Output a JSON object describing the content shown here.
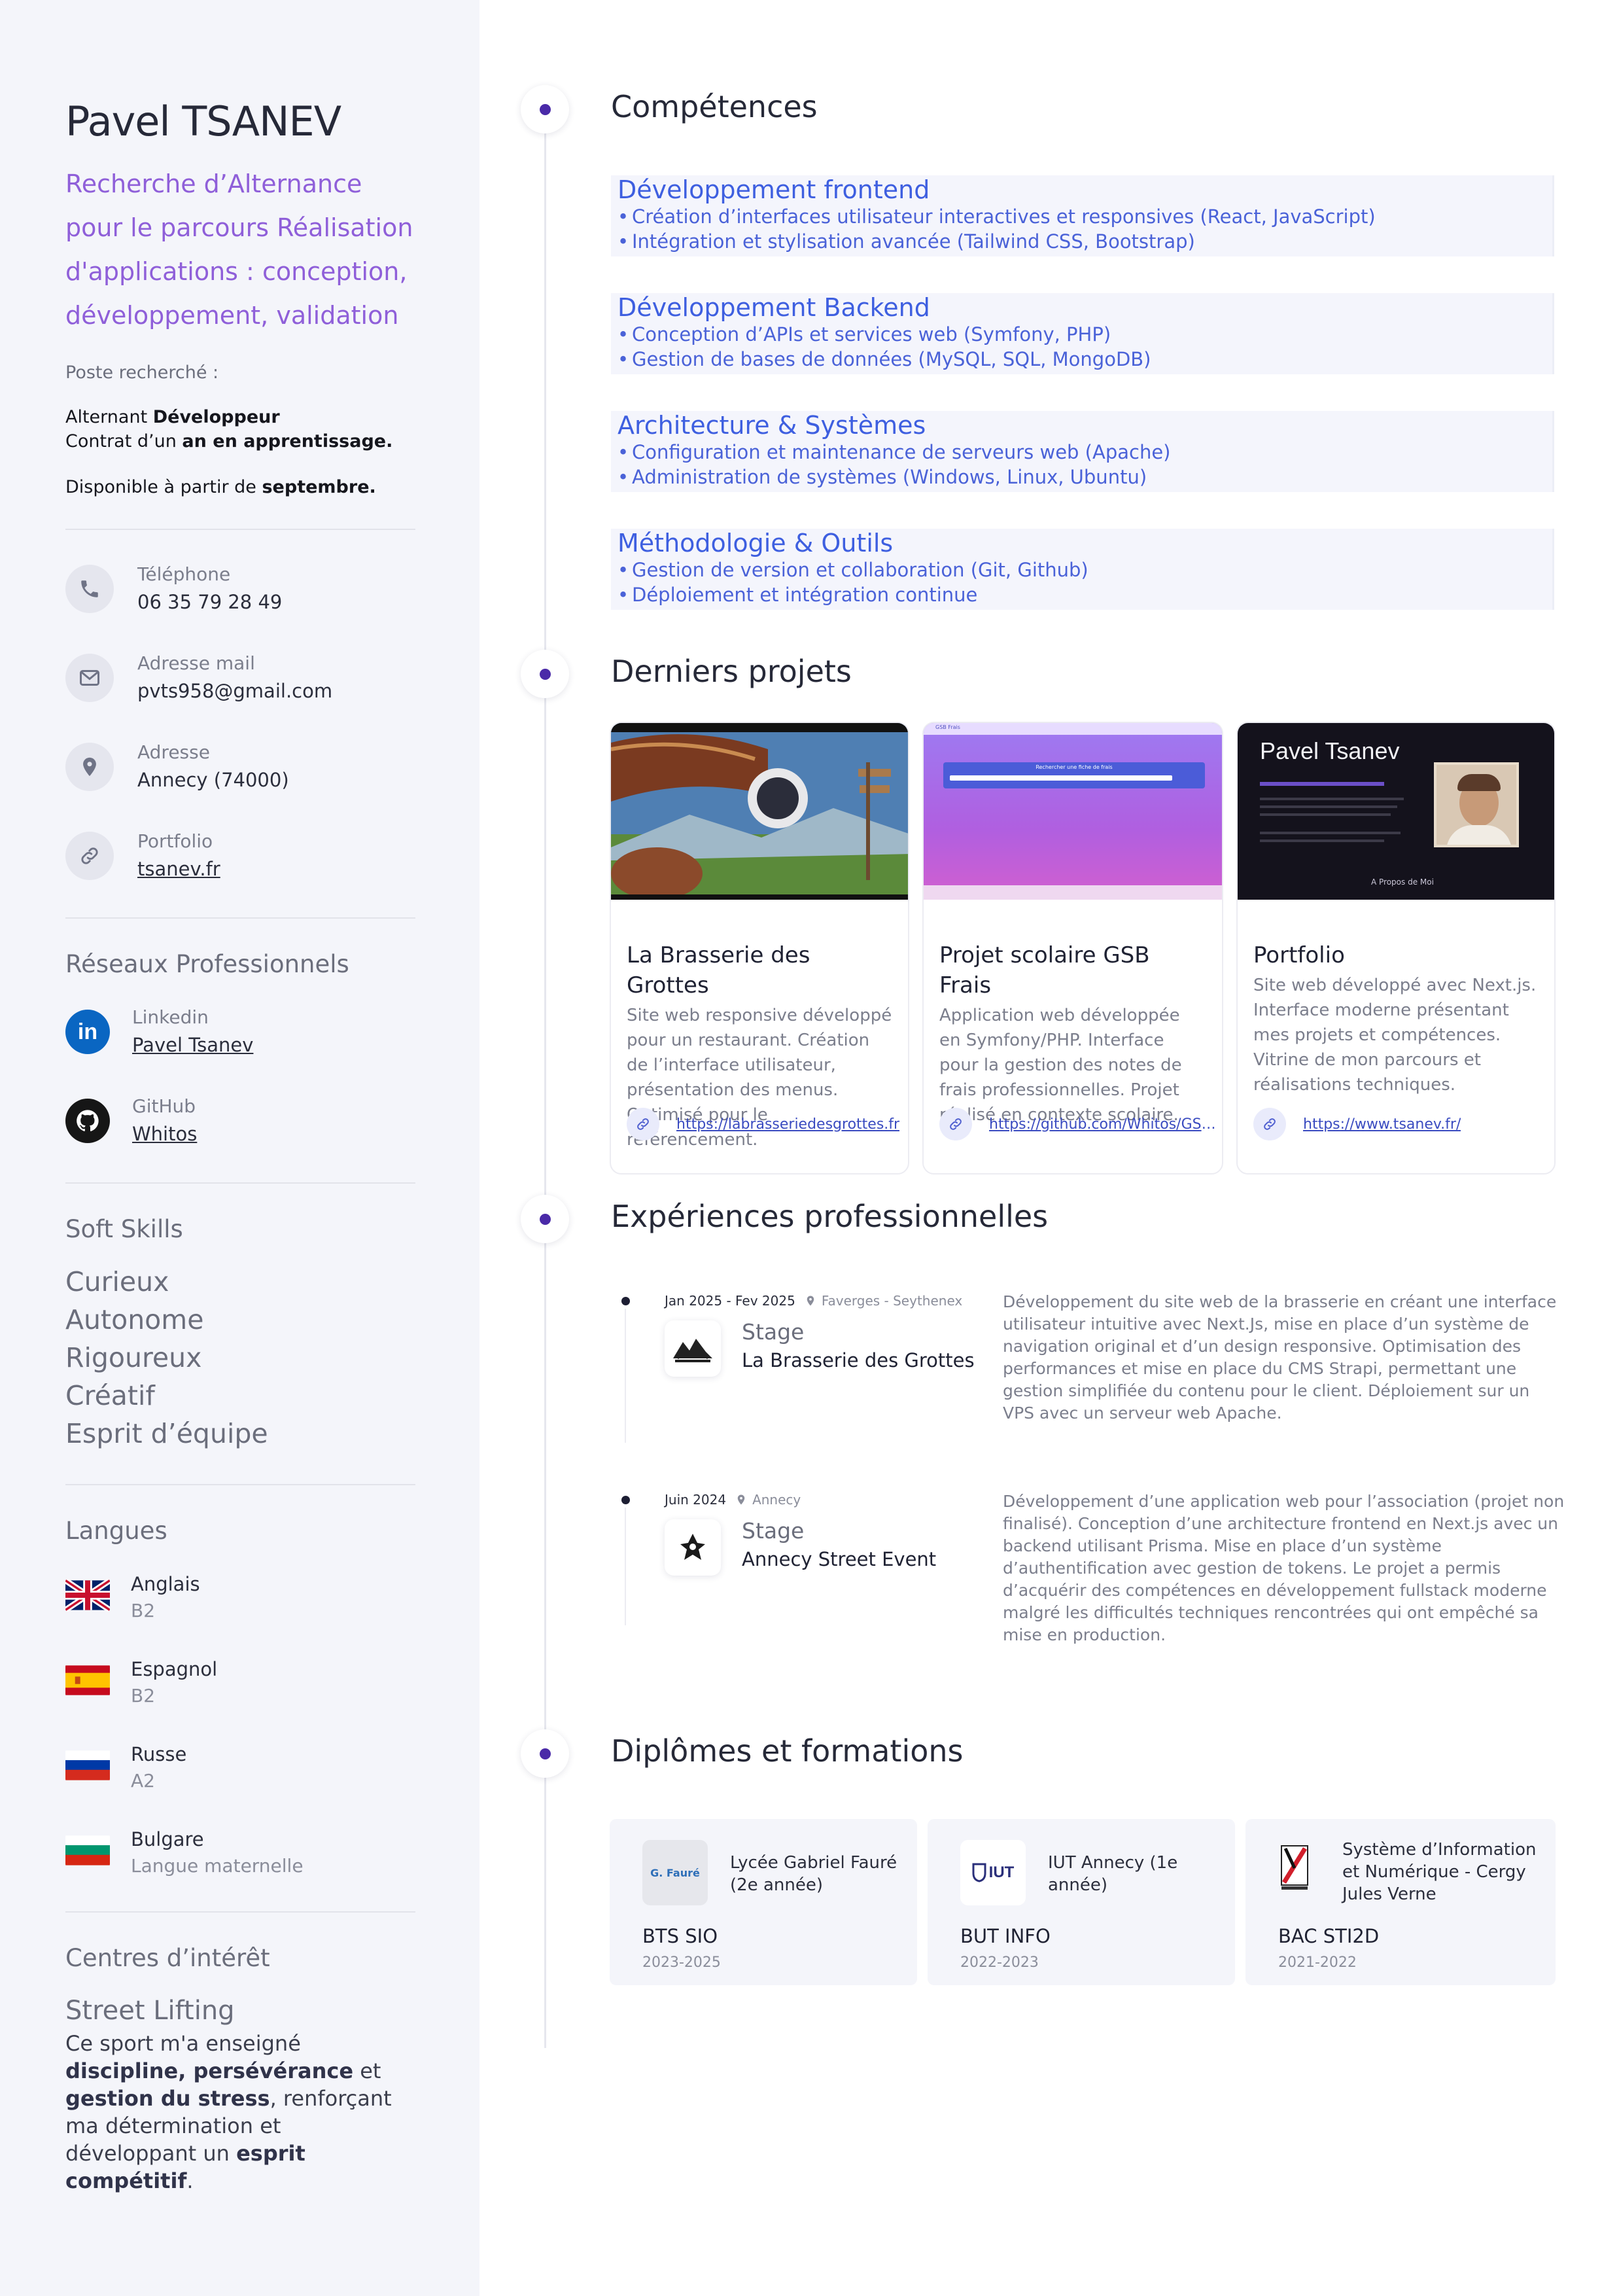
{
  "profile": {
    "name": "Pavel TSANEV",
    "headline": "Recherche d’Alternance pour le parcours Réalisation d'applications : conception, développement, validation",
    "poste_label": "Poste recherché :",
    "poste_line1_prefix": "Alternant ",
    "poste_line1_bold": "Développeur",
    "poste_line2_prefix": "Contrat d’un ",
    "poste_line2_bold": "an en apprentissage.",
    "dispo_prefix": "Disponible à partir de ",
    "dispo_bold": "septembre."
  },
  "contacts": [
    {
      "label": "Téléphone",
      "value": "06 35 79 28 49",
      "icon": "phone-icon"
    },
    {
      "label": "Adresse mail",
      "value": "pvts958@gmail.com",
      "icon": "mail-icon"
    },
    {
      "label": "Adresse",
      "value": "Annecy (74000)",
      "icon": "location-icon"
    },
    {
      "label": "Portfolio",
      "value": "tsanev.fr",
      "icon": "link-icon"
    }
  ],
  "networks": {
    "title": "Réseaux Professionnels",
    "items": [
      {
        "label": "Linkedin",
        "value": "Pavel Tsanev",
        "icon": "linkedin-icon",
        "color": "#0a66c2"
      },
      {
        "label": "GitHub",
        "value": "Whitos",
        "icon": "github-icon",
        "color": "#161616"
      }
    ]
  },
  "soft_skills": {
    "title": "Soft Skills",
    "items": [
      "Curieux",
      "Autonome",
      "Rigoureux",
      "Créatif",
      "Esprit d’équipe"
    ]
  },
  "languages": {
    "title": "Langues",
    "items": [
      {
        "name": "Anglais",
        "level": "B2",
        "icon": "uk-flag-icon"
      },
      {
        "name": "Espagnol",
        "level": "B2",
        "icon": "spain-flag-icon"
      },
      {
        "name": "Russe",
        "level": "A2",
        "icon": "russia-flag-icon"
      },
      {
        "name": "Bulgare",
        "level": "Langue maternelle",
        "icon": "bulgaria-flag-icon"
      }
    ]
  },
  "interests": {
    "title": "Centres d’intérêt",
    "item_title": "Street Lifting",
    "t1": "Ce sport m'a enseigné ",
    "b1": "discipline, persévérance",
    "t2": " et ",
    "b2": "gestion du stress",
    "t3": ", renforçant ma détermination et développant un ",
    "b3": "esprit compétitif",
    "t4": "."
  },
  "sections": {
    "skills": "Compétences",
    "projects": "Derniers projets",
    "experiences": "Expériences professionnelles",
    "education": "Diplômes et formations"
  },
  "skills": [
    {
      "title": "Développement frontend",
      "items": [
        "Création d’interfaces utilisateur interactives et responsives (React, JavaScript)",
        "Intégration et stylisation avancée (Tailwind CSS, Bootstrap)"
      ]
    },
    {
      "title": "Développement Backend",
      "items": [
        "Conception d’APIs et services web (Symfony, PHP)",
        "Gestion de bases de données (MySQL, SQL, MongoDB)"
      ]
    },
    {
      "title": "Architecture & Systèmes",
      "items": [
        "Configuration et maintenance de serveurs web (Apache)",
        "Administration de systèmes (Windows, Linux, Ubuntu)"
      ]
    },
    {
      "title": "Méthodologie & Outils",
      "items": [
        "Gestion de version et collaboration (Git, Github)",
        "Déploiement et intégration continue"
      ]
    }
  ],
  "projects": [
    {
      "title": "La Brasserie des Grottes",
      "desc": "Site web responsive développé pour un restaurant. Création de l’interface utilisateur, présentation des menus. Optimisé pour le référencement.",
      "url": "https://labrasseriedesgrottes.fr"
    },
    {
      "title": "Projet scolaire GSB Frais",
      "desc": "Application web développée en Symfony/PHP. Interface pour la gestion des notes de frais professionnelles. Projet réalisé en contexte scolaire.",
      "url": "https://github.com/Whitos/GSB...",
      "shot_brand": "GSB Frais",
      "shot_banner": "Rechercher une fiche de frais"
    },
    {
      "title": "Portfolio",
      "desc": "Site web développé avec Next.js. Interface moderne présentant mes projets et compétences. Vitrine de mon parcours et réalisations techniques.",
      "url": "https://www.tsanev.fr/",
      "shot_name": "Pavel Tsanev",
      "shot_footer": "A Propos de Moi"
    }
  ],
  "experiences": [
    {
      "dates": "Jan 2025 - Fev 2025",
      "location": "Faverges - Seythenex",
      "type": "Stage",
      "company": "La Brasserie des Grottes",
      "desc": "Développement du site web de la brasserie en créant une interface utilisateur intuitive avec Next.Js, mise en place d’un système de navigation original et d’un design responsive. Optimisation des performances et mise en place du CMS Strapi, permettant une gestion simplifiée du contenu pour le client. Déploiement sur un VPS avec un serveur web Apache."
    },
    {
      "dates": "Juin 2024",
      "location": "Annecy",
      "type": "Stage",
      "company": "Annecy Street Event",
      "desc": "Développement d’une application web pour l’association (projet non finalisé). Conception d’une architecture frontend en Next.js avec un backend utilisant Prisma. Mise en place d’un système d’authentification avec gestion de tokens. Le projet a permis d’acquérir des compétences en développement fullstack moderne malgré les difficultés techniques rencontrées qui ont empêché sa mise en production."
    }
  ],
  "education": [
    {
      "school": "Lycée Gabriel Fauré (2e année)",
      "degree": "BTS SIO",
      "years": "2023-2025",
      "logo_text": "G. Fauré"
    },
    {
      "school": "IUT Annecy (1e année)",
      "degree": "BUT INFO",
      "years": "2022-2023",
      "logo_text": "IUT"
    },
    {
      "school": "Système d’Information et Numérique - Cergy Jules Verne",
      "degree": "BAC STI2D",
      "years": "2021-2022",
      "logo_text": ""
    }
  ],
  "colors": {
    "accent": "#8f5fd9",
    "skill_blue": "#3e5fe0",
    "timeline_dot": "#4a2aa8"
  }
}
